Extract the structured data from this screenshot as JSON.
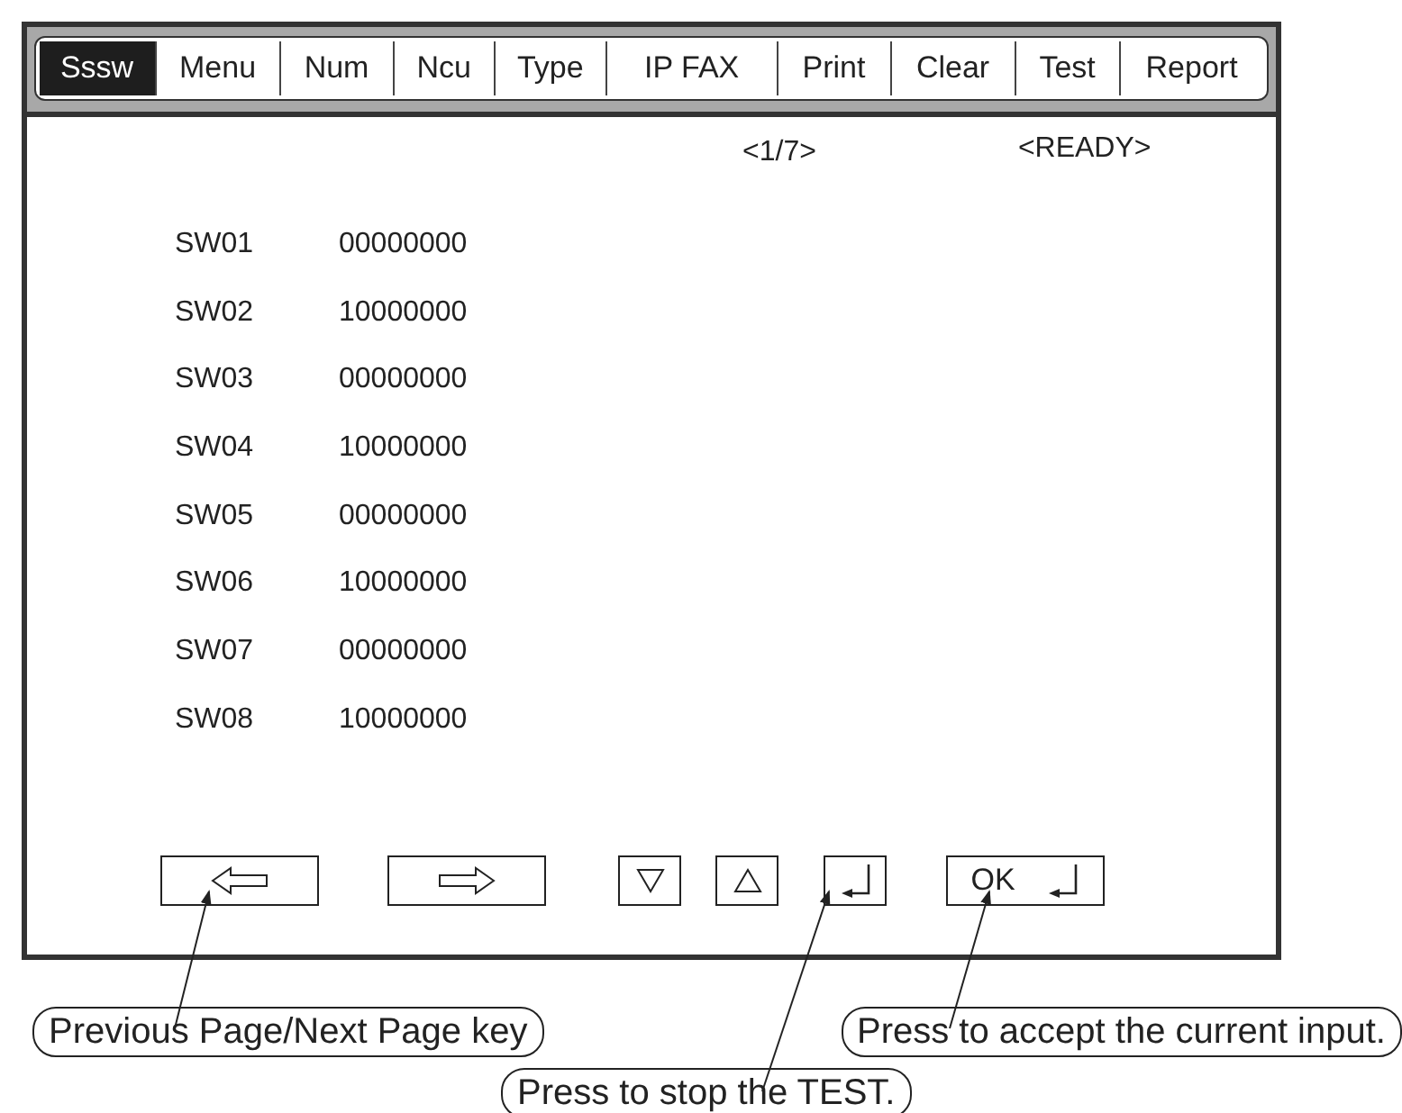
{
  "tabs": [
    {
      "label": "Sssw",
      "selected": true
    },
    {
      "label": "Menu",
      "selected": false
    },
    {
      "label": "Num",
      "selected": false
    },
    {
      "label": "Ncu",
      "selected": false
    },
    {
      "label": "Type",
      "selected": false
    },
    {
      "label": "IP FAX",
      "selected": false
    },
    {
      "label": "Print",
      "selected": false
    },
    {
      "label": "Clear",
      "selected": false
    },
    {
      "label": "Test",
      "selected": false
    },
    {
      "label": "Report",
      "selected": false
    }
  ],
  "page_indicator": "<1/7>",
  "status": "<READY>",
  "switches": [
    {
      "name": "SW01",
      "value": "00000000"
    },
    {
      "name": "SW02",
      "value": "10000000"
    },
    {
      "name": "SW03",
      "value": "00000000"
    },
    {
      "name": "SW04",
      "value": "10000000"
    },
    {
      "name": "SW05",
      "value": "00000000"
    },
    {
      "name": "SW06",
      "value": "10000000"
    },
    {
      "name": "SW07",
      "value": "00000000"
    },
    {
      "name": "SW08",
      "value": "10000000"
    }
  ],
  "keys": [
    {
      "kind": "prev"
    },
    {
      "kind": "next"
    },
    {
      "kind": "down"
    },
    {
      "kind": "up"
    },
    {
      "kind": "enter"
    },
    {
      "kind": "ok",
      "label": "OK"
    }
  ],
  "callouts": [
    "Previous Page/Next Page key",
    "Press to accept the current input.",
    "Press to stop the TEST."
  ]
}
